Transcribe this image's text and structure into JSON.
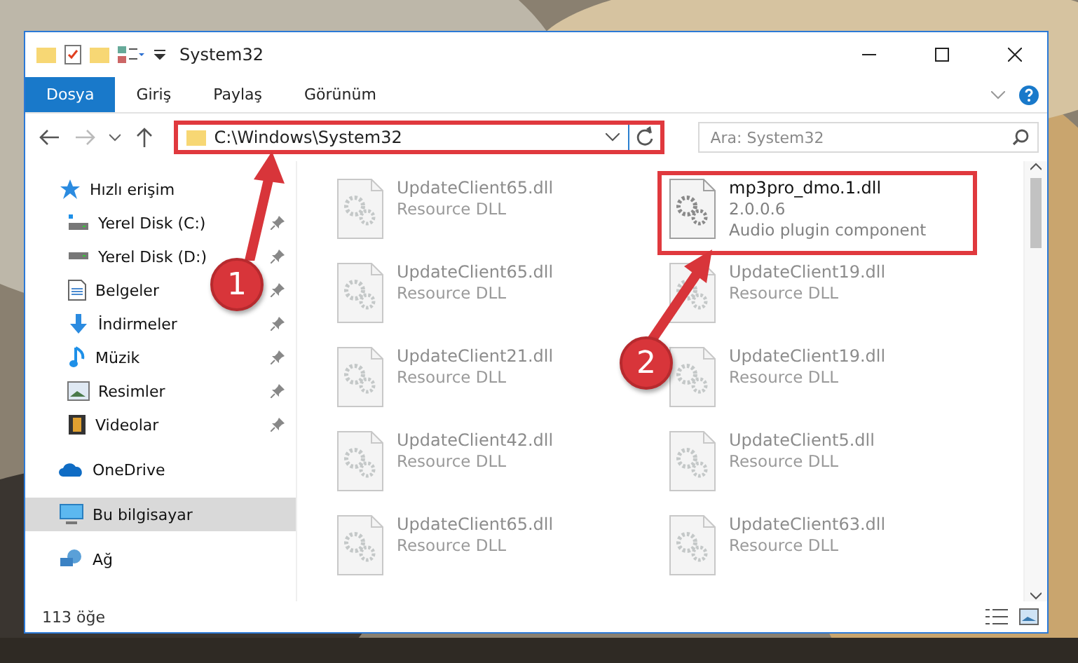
{
  "window": {
    "title": "System32"
  },
  "tabs": [
    {
      "label": "Dosya",
      "kind": "file",
      "selected": false
    },
    {
      "label": "Giriş",
      "kind": "tab",
      "selected": false
    },
    {
      "label": "Paylaş",
      "kind": "tab",
      "selected": false
    },
    {
      "label": "Görünüm",
      "kind": "tab",
      "selected": false
    }
  ],
  "address": {
    "path": "C:\\Windows\\System32",
    "highlighted": true
  },
  "search": {
    "placeholder": "Ara: System32"
  },
  "sidebar": {
    "items": [
      {
        "label": "Hızlı erişim",
        "selected": false,
        "children": [
          {
            "label": "Yerel Disk (C:)",
            "selected": false,
            "pinned": true
          },
          {
            "label": "Yerel Disk (D:)",
            "selected": false,
            "pinned": true
          },
          {
            "label": "Belgeler",
            "selected": false,
            "pinned": true
          },
          {
            "label": "İndirmeler",
            "selected": false,
            "pinned": true
          },
          {
            "label": "Müzik",
            "selected": false,
            "pinned": true
          },
          {
            "label": "Resimler",
            "selected": false,
            "pinned": true
          },
          {
            "label": "Videolar",
            "selected": false,
            "pinned": true
          }
        ]
      },
      {
        "label": "OneDrive",
        "selected": false
      },
      {
        "label": "Bu bilgisayar",
        "selected": true
      },
      {
        "label": "Ağ",
        "selected": false
      }
    ]
  },
  "files": [
    {
      "name": "UpdateClient65.dll",
      "details": [
        "Resource DLL"
      ],
      "blurred": true,
      "highlighted": false
    },
    {
      "name": "mp3pro_dmo.1.dll",
      "details": [
        "2.0.0.6",
        "Audio plugin component"
      ],
      "blurred": false,
      "highlighted": true
    },
    {
      "name": "UpdateClient65.dll",
      "details": [
        "Resource DLL"
      ],
      "blurred": true,
      "highlighted": false
    },
    {
      "name": "UpdateClient19.dll",
      "details": [
        "Resource DLL"
      ],
      "blurred": true,
      "highlighted": false
    },
    {
      "name": "UpdateClient21.dll",
      "details": [
        "Resource DLL"
      ],
      "blurred": true,
      "highlighted": false
    },
    {
      "name": "UpdateClient19.dll",
      "details": [
        "Resource DLL"
      ],
      "blurred": true,
      "highlighted": false
    },
    {
      "name": "UpdateClient42.dll",
      "details": [
        "Resource DLL"
      ],
      "blurred": true,
      "highlighted": false
    },
    {
      "name": "UpdateClient5.dll",
      "details": [
        "Resource DLL"
      ],
      "blurred": true,
      "highlighted": false
    },
    {
      "name": "UpdateClient65.dll",
      "details": [
        "Resource DLL"
      ],
      "blurred": true,
      "highlighted": false
    },
    {
      "name": "UpdateClient63.dll",
      "details": [
        "Resource DLL"
      ],
      "blurred": true,
      "highlighted": false
    }
  ],
  "status_bar": {
    "count": "113 öğe"
  },
  "annotations": [
    {
      "label": "1"
    },
    {
      "label": "2"
    }
  ]
}
